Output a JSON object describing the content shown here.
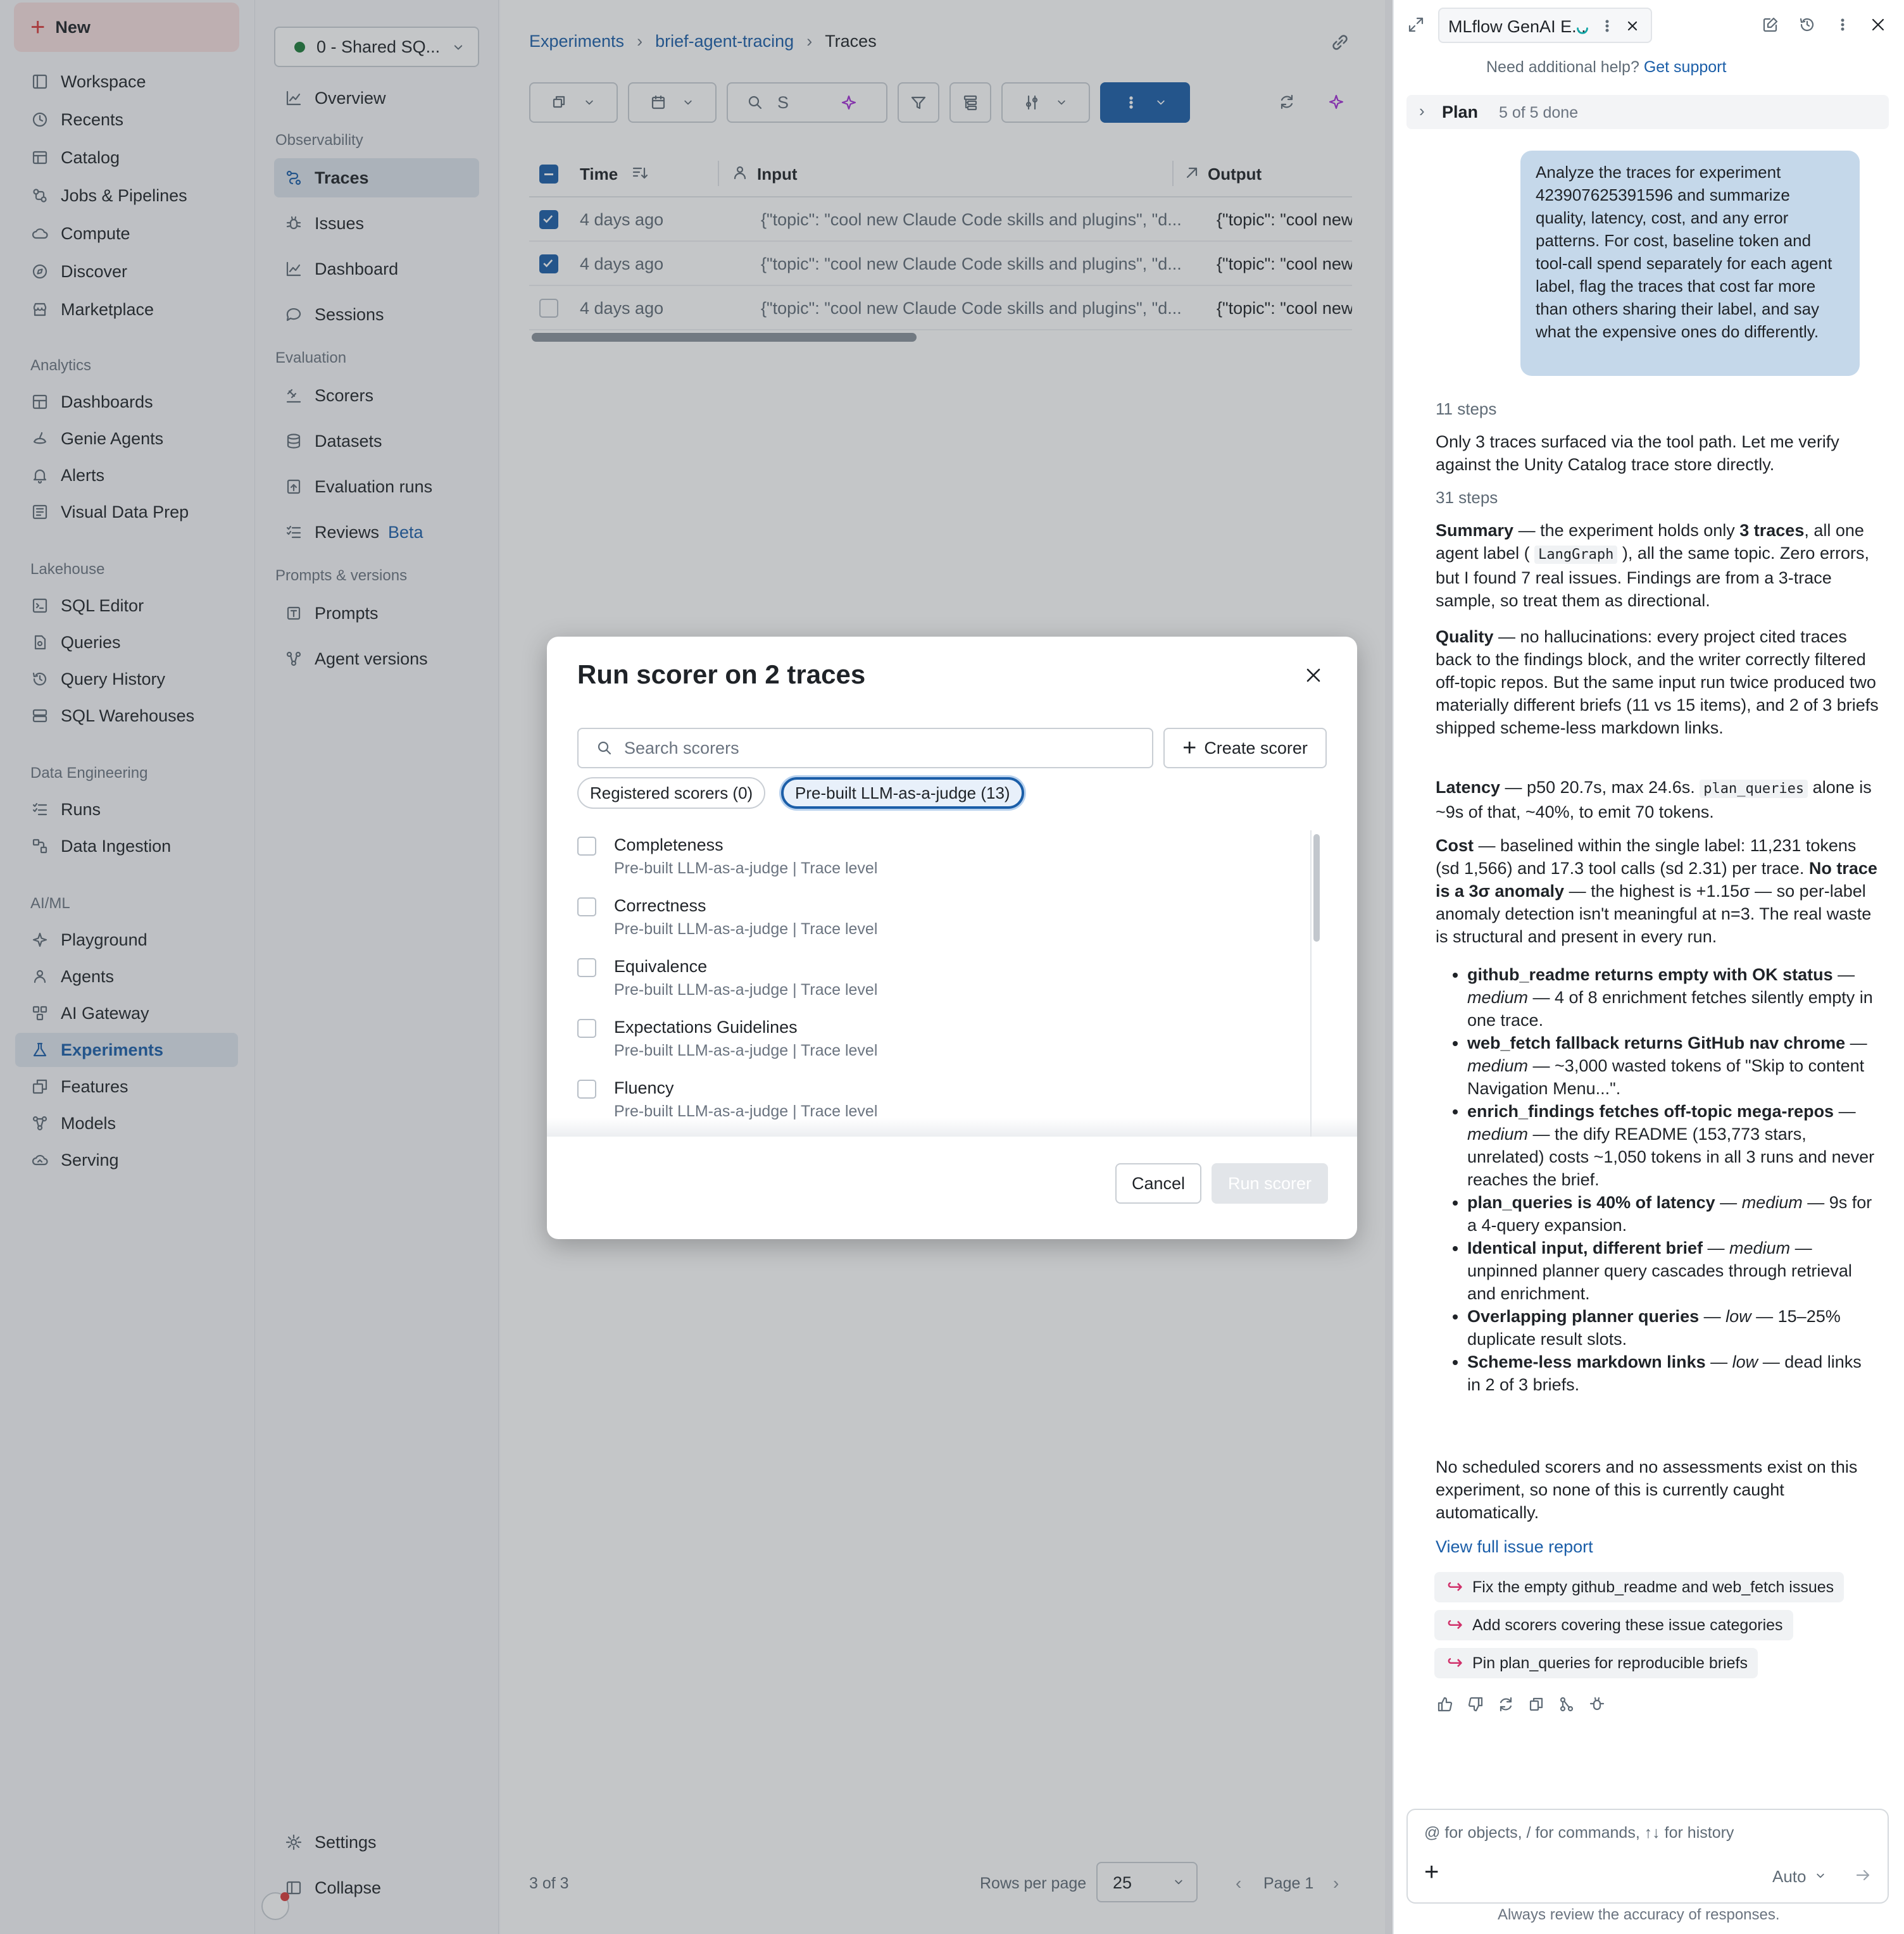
{
  "leftnav": {
    "new_label": "New",
    "items": [
      {
        "label": "Workspace",
        "icon": "workspace-icon"
      },
      {
        "label": "Recents",
        "icon": "clock-icon"
      },
      {
        "label": "Catalog",
        "icon": "catalog-icon"
      },
      {
        "label": "Jobs & Pipelines",
        "icon": "pipelines-icon"
      },
      {
        "label": "Compute",
        "icon": "cloud-icon"
      },
      {
        "label": "Discover",
        "icon": "compass-icon"
      },
      {
        "label": "Marketplace",
        "icon": "store-icon"
      }
    ],
    "analytics_label": "Analytics",
    "analytics": [
      {
        "label": "Dashboards"
      },
      {
        "label": "Genie Agents"
      },
      {
        "label": "Alerts"
      },
      {
        "label": "Visual Data Prep"
      }
    ],
    "lakehouse_label": "Lakehouse",
    "lakehouse": [
      {
        "label": "SQL Editor"
      },
      {
        "label": "Queries"
      },
      {
        "label": "Query History"
      },
      {
        "label": "SQL Warehouses"
      }
    ],
    "dataeng_label": "Data Engineering",
    "dataeng": [
      {
        "label": "Runs"
      },
      {
        "label": "Data Ingestion"
      }
    ],
    "aiml_label": "AI/ML",
    "aiml": [
      {
        "label": "Playground"
      },
      {
        "label": "Agents"
      },
      {
        "label": "AI Gateway"
      },
      {
        "label": "Experiments"
      },
      {
        "label": "Features"
      },
      {
        "label": "Models"
      },
      {
        "label": "Serving"
      }
    ]
  },
  "expside": {
    "warehouse": "0 - Shared SQ...",
    "overview": "Overview",
    "observability_label": "Observability",
    "observability": [
      {
        "label": "Traces"
      },
      {
        "label": "Issues"
      },
      {
        "label": "Dashboard"
      },
      {
        "label": "Sessions"
      }
    ],
    "evaluation_label": "Evaluation",
    "evaluation": [
      {
        "label": "Scorers"
      },
      {
        "label": "Datasets"
      },
      {
        "label": "Evaluation runs"
      },
      {
        "label": "Reviews"
      }
    ],
    "beta": "Beta",
    "prompts_label": "Prompts & versions",
    "prompts": [
      {
        "label": "Prompts"
      },
      {
        "label": "Agent versions"
      }
    ],
    "settings": "Settings",
    "collapse": "Collapse"
  },
  "main": {
    "crumbs": [
      "Experiments",
      "brief-agent-tracing",
      "Traces"
    ],
    "search_value": "S",
    "columns": {
      "time": "Time",
      "input": "Input",
      "output": "Output"
    },
    "rows": [
      {
        "time": "4 days ago",
        "input": "{\"topic\": \"cool new Claude Code skills and plugins\", \"d...",
        "output": "{\"topic\": \"cool new Cla",
        "checked": true
      },
      {
        "time": "4 days ago",
        "input": "{\"topic\": \"cool new Claude Code skills and plugins\", \"d...",
        "output": "{\"topic\": \"cool new Cla",
        "checked": true
      },
      {
        "time": "4 days ago",
        "input": "{\"topic\": \"cool new Claude Code skills and plugins\", \"d...",
        "output": "{\"topic\": \"cool new Cla",
        "checked": false
      }
    ],
    "count": "3 of 3",
    "rows_per_page_label": "Rows per page",
    "rows_per_page": "25",
    "page": "Page 1",
    "primary_color": "#1b5ea8"
  },
  "modal": {
    "title": "Run scorer on 2 traces",
    "search_placeholder": "Search scorers",
    "create": "Create scorer",
    "tab_registered": "Registered scorers (0)",
    "tab_prebuilt": "Pre-built LLM-as-a-judge (13)",
    "scorers": [
      {
        "name": "Completeness",
        "desc": "Pre-built LLM-as-a-judge | Trace level"
      },
      {
        "name": "Correctness",
        "desc": "Pre-built LLM-as-a-judge | Trace level"
      },
      {
        "name": "Equivalence",
        "desc": "Pre-built LLM-as-a-judge | Trace level"
      },
      {
        "name": "Expectations Guidelines",
        "desc": "Pre-built LLM-as-a-judge | Trace level"
      },
      {
        "name": "Fluency",
        "desc": "Pre-built LLM-as-a-judge | Trace level"
      }
    ],
    "cancel": "Cancel",
    "run": "Run scorer"
  },
  "assist": {
    "title": "MLflow GenAI E...",
    "help": "Need additional help?",
    "support": "Get support",
    "plan": "Plan",
    "plan_status": "5 of 5 done",
    "user_msg": "Analyze the traces for experiment 423907625391596 and summarize quality, latency, cost, and any error patterns. For cost, baseline token and tool-call spend separately for each agent label, flag the traces that cost far more than others sharing their label, and say what the expensive ones do differently.",
    "steps1": "11 steps",
    "msg1": "Only 3 traces surfaced via the tool path. Let me verify against the Unity Catalog trace store directly.",
    "steps2": "31 steps",
    "summary_h": "Summary",
    "summary_a": " — the experiment holds only ",
    "summary_b": "3 traces",
    "summary_c": ", all one agent label ( ",
    "summary_code": "LangGraph",
    "summary_d": " ), all the same topic. Zero errors, but I found 7 real issues. Findings are from a 3-trace sample, so treat them as directional.",
    "quality_h": "Quality",
    "quality": " — no hallucinations: every project cited traces back to the findings block, and the writer correctly filtered off-topic repos. But the same input run twice produced two materially different briefs (11 vs 15 items), and 2 of 3 briefs shipped scheme-less markdown links.",
    "latency_h": "Latency",
    "latency_a": " — p50 20.7s, max 24.6s. ",
    "latency_code": "plan_queries",
    "latency_b": " alone is ~9s of that, ~40%, to emit 70 tokens.",
    "cost_h": "Cost",
    "cost_a": " — baselined within the single label: 11,231 tokens (sd 1,566) and 17.3 tool calls (sd 2.31) per trace. ",
    "cost_b": "No trace is a 3σ anomaly",
    "cost_c": " — the highest is +1.15σ — so per-label anomaly detection isn't meaningful at n=3. The real waste is structural and present in every run.",
    "issues": [
      {
        "b": "github_readme returns empty with OK status",
        "s": "medium",
        "t": " — 4 of 8 enrichment fetches silently empty in one trace."
      },
      {
        "b": "web_fetch fallback returns GitHub nav chrome",
        "s": "medium",
        "t": " — ~3,000 wasted tokens of \"Skip to content Navigation Menu...\"."
      },
      {
        "b": "enrich_findings fetches off-topic mega-repos",
        "s": "medium",
        "t": " — the dify README (153,773 stars, unrelated) costs ~1,050 tokens in all 3 runs and never reaches the brief."
      },
      {
        "b": "plan_queries is 40% of latency",
        "s": "medium",
        "t": " — 9s for a 4-query expansion."
      },
      {
        "b": "Identical input, different brief",
        "s": "medium",
        "t": " — unpinned planner query cascades through retrieval and enrichment."
      },
      {
        "b": "Overlapping planner queries",
        "s": "low",
        "t": " — 15–25% duplicate result slots."
      },
      {
        "b": "Scheme-less markdown links",
        "s": "low",
        "t": " — dead links in 2 of 3 briefs."
      }
    ],
    "closing": "No scheduled scorers and no assessments exist on this experiment, so none of this is currently caught automatically.",
    "report_link": "View full issue report",
    "suggestions": [
      "Fix the empty github_readme and web_fetch issues",
      "Add scorers covering these issue categories",
      "Pin plan_queries for reproducible briefs"
    ],
    "input_placeholder": "@ for objects, / for commands, ↑↓ for history",
    "mode": "Auto",
    "disclaimer": "Always review the accuracy of responses."
  }
}
